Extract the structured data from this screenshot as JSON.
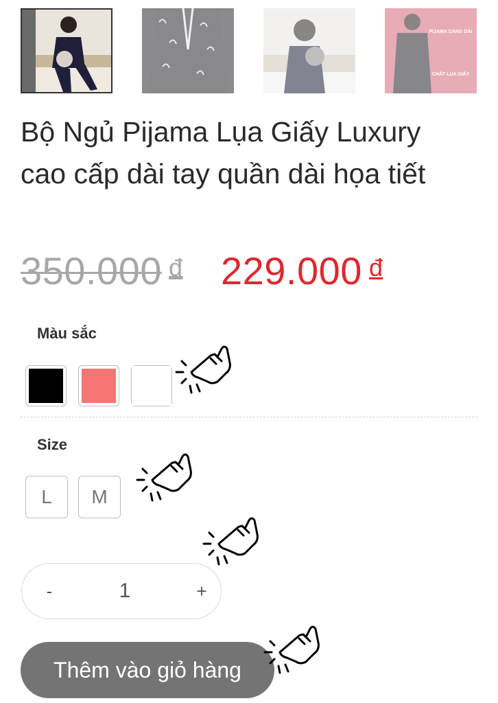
{
  "product": {
    "title": "Bộ Ngủ Pijama Lụa Giấy Luxury cao cấp dài tay quần dài họa tiết",
    "old_price": "350.000",
    "new_price": "229.000",
    "currency": "đ"
  },
  "gallery": {
    "thumbnail_4_heading": "PIJAMA DÁNG DÀI",
    "thumbnail_4_caption": "CHẤT LỤA GIẤY"
  },
  "color": {
    "label": "Màu sắc",
    "options": [
      {
        "name": "black",
        "hex": "#000000"
      },
      {
        "name": "pink",
        "hex": "#f57575"
      },
      {
        "name": "white",
        "hex": "#ffffff"
      }
    ]
  },
  "size": {
    "label": "Size",
    "options": [
      "L",
      "M"
    ]
  },
  "quantity": {
    "minus": "-",
    "value": "1",
    "plus": "+"
  },
  "cart": {
    "add_label": "Thêm vào giỏ hàng"
  },
  "colors": {
    "sale_red": "#e0262f",
    "button_gray": "#747474"
  }
}
